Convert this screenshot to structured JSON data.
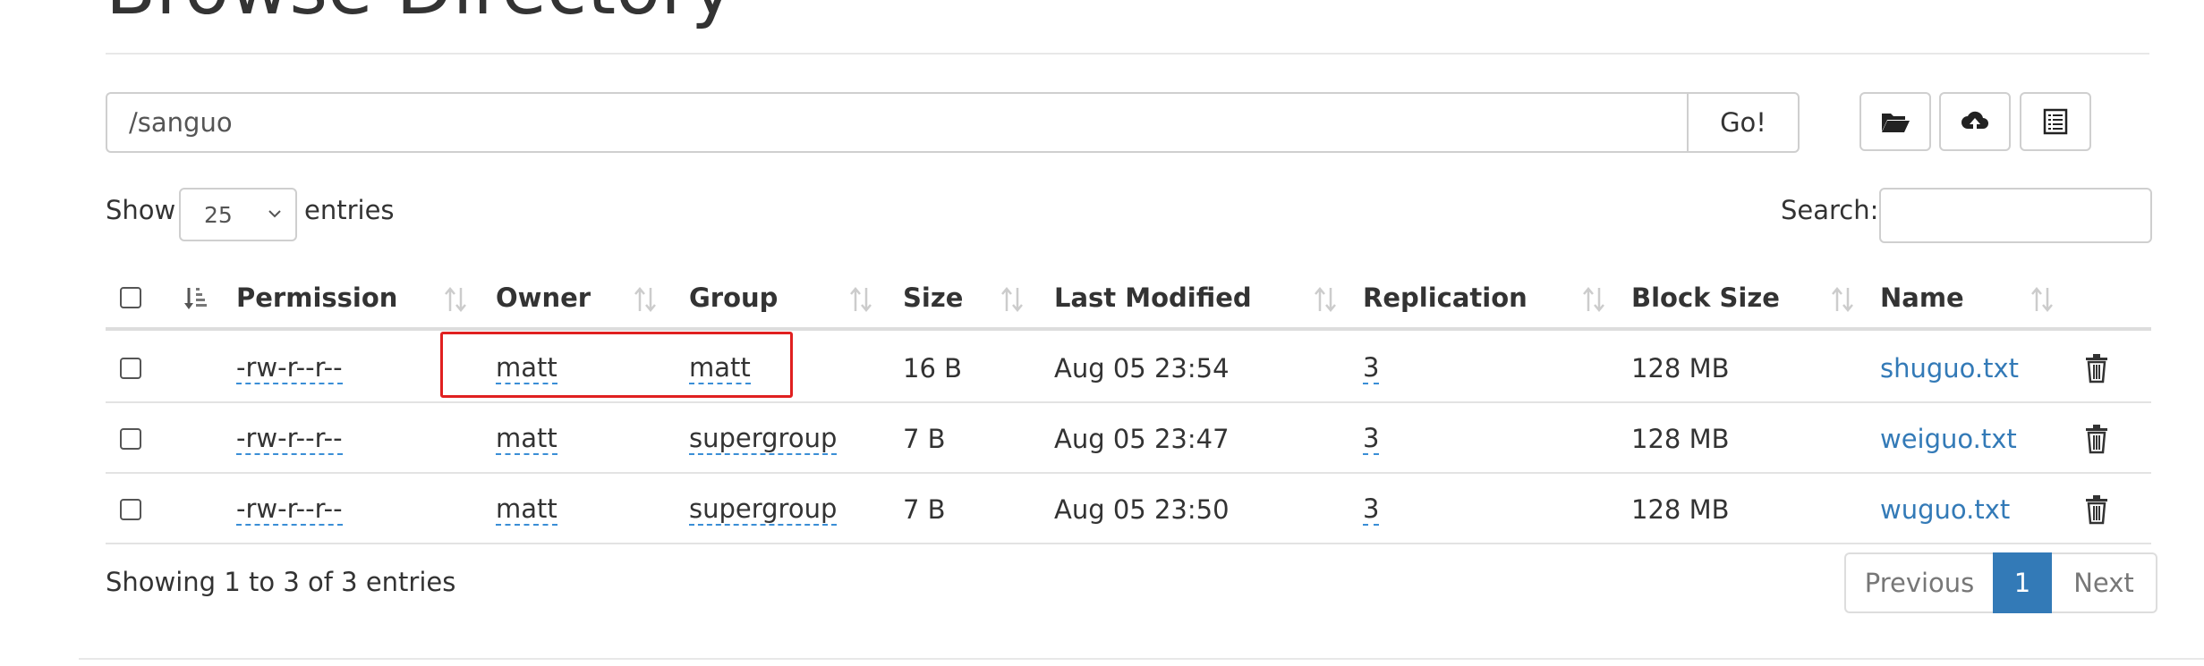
{
  "page": {
    "title": "Browse Directory"
  },
  "path_bar": {
    "value": "/sanguo",
    "go_label": "Go!"
  },
  "toolbar": {
    "buttons": [
      {
        "icon": "folder-open-icon"
      },
      {
        "icon": "cloud-upload-icon"
      },
      {
        "icon": "list-icon"
      }
    ]
  },
  "length_control": {
    "show_label": "Show",
    "selected": "25",
    "entries_label": "entries"
  },
  "search": {
    "label": "Search:",
    "value": ""
  },
  "table": {
    "columns": [
      "Permission",
      "Owner",
      "Group",
      "Size",
      "Last Modified",
      "Replication",
      "Block Size",
      "Name"
    ],
    "rows": [
      {
        "permission": "-rw-r--r--",
        "owner": "matt",
        "group": "matt",
        "size": "16 B",
        "last_modified": "Aug 05 23:54",
        "replication": "3",
        "block_size": "128 MB",
        "name": "shuguo.txt"
      },
      {
        "permission": "-rw-r--r--",
        "owner": "matt",
        "group": "supergroup",
        "size": "7 B",
        "last_modified": "Aug 05 23:47",
        "replication": "3",
        "block_size": "128 MB",
        "name": "weiguo.txt"
      },
      {
        "permission": "-rw-r--r--",
        "owner": "matt",
        "group": "supergroup",
        "size": "7 B",
        "last_modified": "Aug 05 23:50",
        "replication": "3",
        "block_size": "128 MB",
        "name": "wuguo.txt"
      }
    ]
  },
  "footer": {
    "info": "Showing 1 to 3 of 3 entries"
  },
  "pagination": {
    "previous": "Previous",
    "current": "1",
    "next": "Next"
  },
  "colors": {
    "link": "#337ab7",
    "highlight": "#e02020",
    "accent": "#337ab7"
  }
}
